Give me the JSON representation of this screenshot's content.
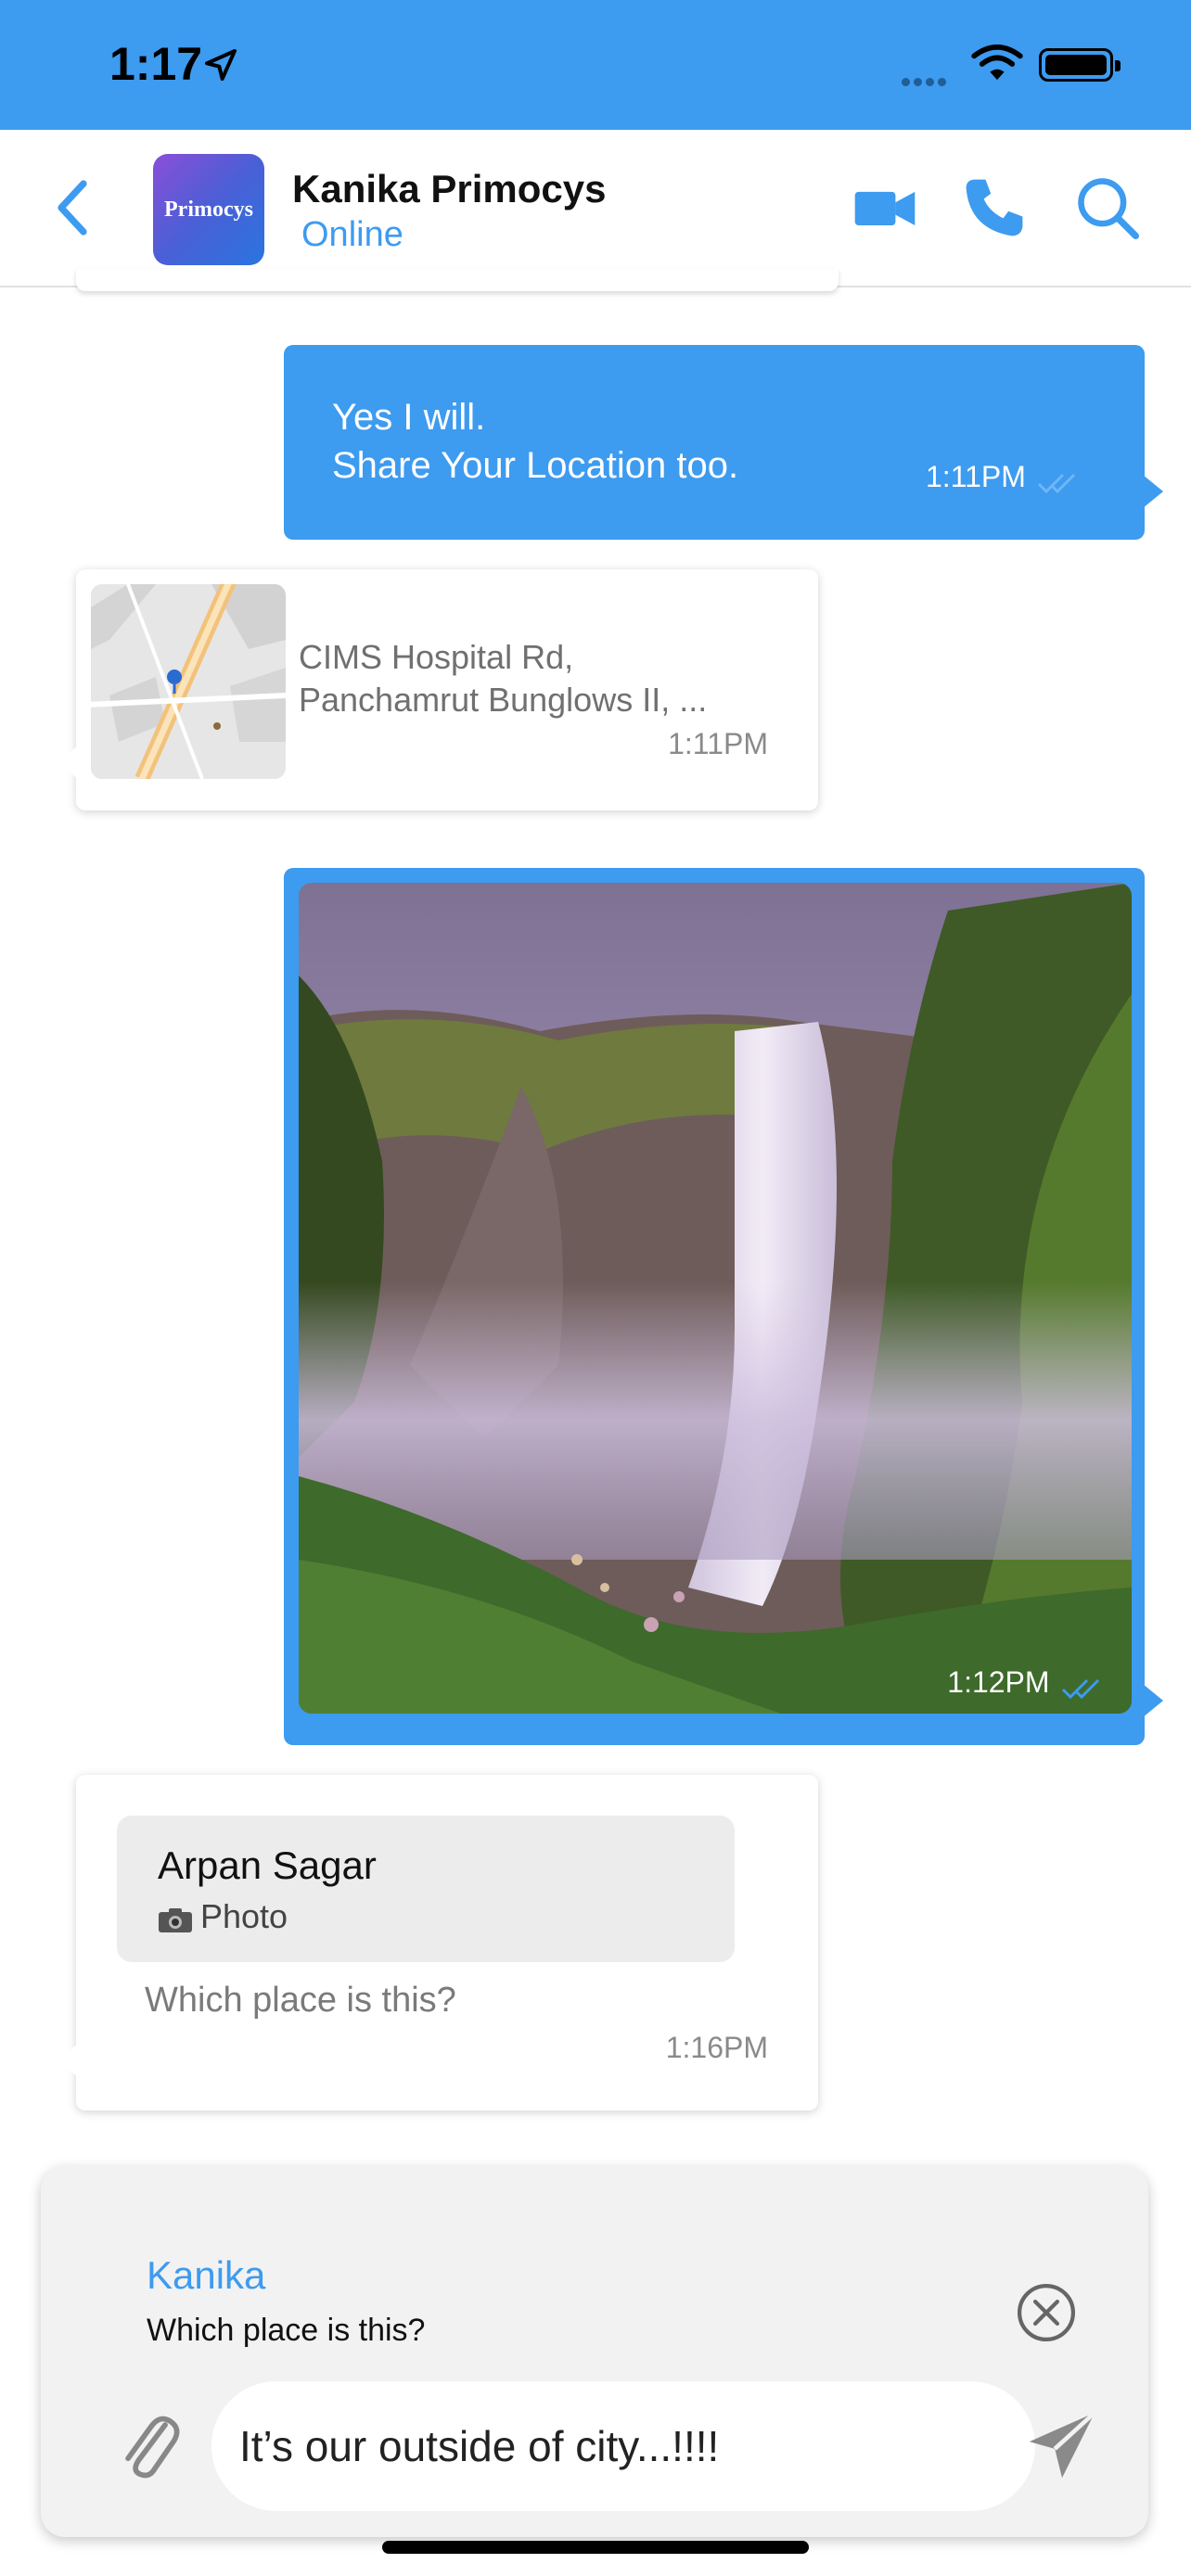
{
  "status_bar": {
    "time": "1:17"
  },
  "header": {
    "back_icon": "chevron-left-icon",
    "avatar_text": "Primocys",
    "contact_name": "Kanika Primocys",
    "status": "Online",
    "actions": [
      "video-call-icon",
      "phone-icon",
      "search-icon"
    ]
  },
  "messages": [
    {
      "type": "text",
      "direction": "outgoing",
      "lines": [
        "Yes I will.",
        "Share Your Location too."
      ],
      "time": "1:11PM",
      "read": true
    },
    {
      "type": "location",
      "direction": "incoming",
      "address_line1": "CIMS Hospital Rd,",
      "address_line2": "Panchamrut Bunglows II, ...",
      "time": "1:11PM"
    },
    {
      "type": "image",
      "direction": "outgoing",
      "time": "1:12PM",
      "read": true
    },
    {
      "type": "reply",
      "direction": "incoming",
      "quoted_sender": "Arpan Sagar",
      "quoted_icon": "camera-icon",
      "quoted_label": "Photo",
      "text": "Which place is this?",
      "time": "1:16PM"
    }
  ],
  "composer": {
    "reply_to_name": "Kanika",
    "reply_to_text": "Which place is this?",
    "input_value": "It’s our outside of city...!!!!"
  },
  "colors": {
    "accent": "#3d9bf0",
    "bubble_in": "#ffffff",
    "reply_card": "#ececec"
  }
}
